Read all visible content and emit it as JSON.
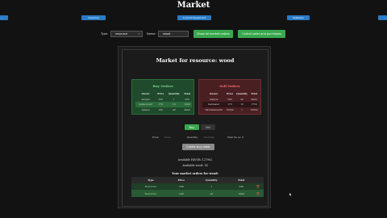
{
  "header": {
    "title": "Market"
  },
  "nav": {
    "left_partial": "...",
    "inventory": "Inventory",
    "current_equipment": "Current Equipment",
    "statistics": "Statistics",
    "right_partial": "..."
  },
  "filters": {
    "type_label": "Type:",
    "type_value": "resource",
    "name_label": "Name:",
    "name_value": "wood",
    "show_all_button": "Show all market orders",
    "collect_button": "Collect sales and purchases"
  },
  "market": {
    "title": "Market for resource: wood",
    "buy_orders": {
      "heading": "Buy Orders",
      "columns": [
        "Owner",
        "Price",
        "Quantity",
        "Total"
      ],
      "rows": [
        [
          "mergel",
          "230",
          "1",
          "230"
        ],
        [
          "testaccount",
          "170",
          "10",
          "1000"
        ],
        [
          "tempel",
          "100",
          "40",
          "4000"
        ]
      ]
    },
    "sell_orders": {
      "heading": "Sell Orders",
      "columns": [
        "Owner",
        "Price",
        "Quantity",
        "Total"
      ],
      "rows": [
        [
          "tempus",
          "500",
          "20",
          "9000"
        ],
        [
          "testdealer",
          "175",
          "10",
          "1750"
        ],
        [
          "tiltwithwrealth",
          "10000",
          "1",
          "10000"
        ]
      ]
    },
    "tabs": {
      "buy": "Buy",
      "sell": "Sell"
    },
    "order_form": {
      "price_label": "Price:",
      "price_placeholder": "Price",
      "quantity_label": "Quantity:",
      "quantity_placeholder": "Quantity",
      "total_label": "Total Se ce:",
      "total_value": "0"
    },
    "create_button": "Create buy order",
    "available_currency": "Available FAVOR: 127902",
    "available_resource": "Available wood: 14",
    "my_orders": {
      "title": "Your market orders for wood:",
      "columns": [
        "Type",
        "Price",
        "Quantity",
        "Total"
      ],
      "rows": [
        {
          "type": "BuyOrder",
          "price": "230",
          "quantity": "1",
          "total": "230"
        },
        {
          "type": "BuyOrder",
          "price": "100",
          "quantity": "10",
          "total": "1000"
        }
      ]
    }
  },
  "colors": {
    "accent_green": "#3aa84e",
    "nav_blue": "#2a7cc7",
    "sell_red": "#ff6b6b"
  },
  "icons": [
    "trash-icon",
    "cursor-icon"
  ]
}
